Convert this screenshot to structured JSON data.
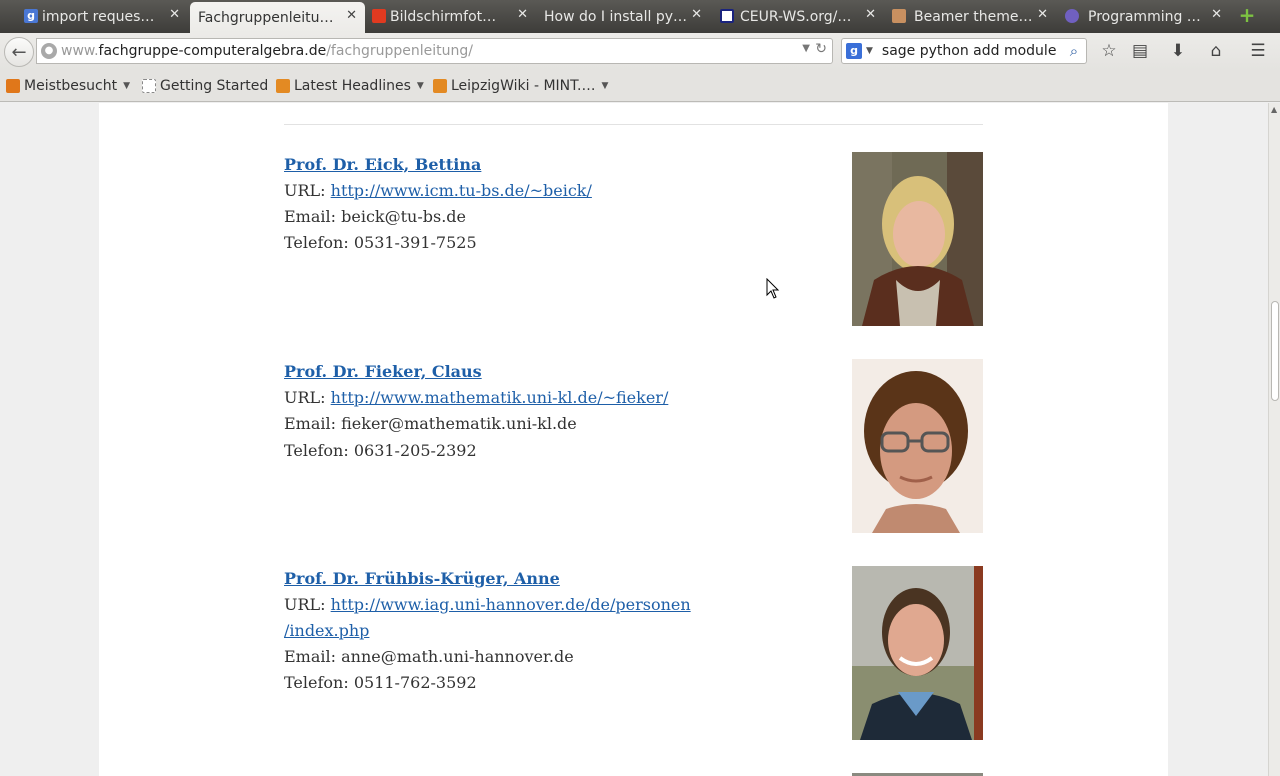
{
  "tabs": [
    {
      "title": "import reques…",
      "icon_color": "#4a77d4",
      "icon": "google-icon",
      "active": false
    },
    {
      "title": "Fachgruppenleitu…",
      "icon_color": "",
      "icon": "",
      "active": true
    },
    {
      "title": "Bildschirmfot…",
      "icon_color": "#e03a20",
      "icon": "bildschirmfoto-icon",
      "active": false
    },
    {
      "title": "How do I install py…",
      "icon_color": "",
      "icon": "",
      "active": false
    },
    {
      "title": "CEUR-WS.org/…",
      "icon_color": "#1a237e",
      "icon": "ceur-icon",
      "active": false
    },
    {
      "title": "Beamer theme…",
      "icon_color": "#c89060",
      "icon": "beamer-icon",
      "active": false
    },
    {
      "title": "Programming …",
      "icon_color": "#7060c0",
      "icon": "programming-icon",
      "active": false
    }
  ],
  "navbar": {
    "url_prefix": "www.",
    "url_domain": "fachgruppe-computeralgebra.de",
    "url_path": "/fachgruppenleitung/",
    "search_engine_letter": "g",
    "search_query": "sage python add module"
  },
  "bookmarks": [
    {
      "label": "Meistbesucht",
      "dropdown": true,
      "icon": "most-visited-icon",
      "icon_color": "#e0771a"
    },
    {
      "label": "Getting Started",
      "dropdown": false,
      "icon": "page-icon",
      "icon_color": "#bbbbbb"
    },
    {
      "label": "Latest Headlines",
      "dropdown": true,
      "icon": "rss-icon",
      "icon_color": "#e38a23"
    },
    {
      "label": "LeipzigWiki - MINT.…",
      "dropdown": true,
      "icon": "rss-icon",
      "icon_color": "#e38a23"
    }
  ],
  "people": [
    {
      "name": "Prof. Dr. Eick, Bettina",
      "url_label": "URL:",
      "url_lines": [
        "http://www.icm.tu-bs.de/~beick/"
      ],
      "email_label": "Email:",
      "email": "beick@tu-bs.de",
      "phone_label": "Telefon:",
      "phone": "0531-391-7525"
    },
    {
      "name": "Prof. Dr. Fieker, Claus",
      "url_label": "URL:",
      "url_lines": [
        "http://www.mathematik.uni-kl.de/~fieker/"
      ],
      "email_label": "Email:",
      "email": "fieker@mathematik.uni-kl.de",
      "phone_label": "Telefon:",
      "phone": "0631-205-2392"
    },
    {
      "name": "Prof. Dr. Frühbis-Krüger, Anne",
      "url_label": "URL:",
      "url_lines": [
        "http://www.iag.uni-hannover.de/de/personen",
        "/index.php"
      ],
      "email_label": "Email:",
      "email": "anne@math.uni-hannover.de",
      "phone_label": "Telefon:",
      "phone": "0511-762-3592"
    }
  ],
  "colors": {
    "link": "#1e5fa8",
    "text": "#333333",
    "page_bg": "#efefef"
  }
}
